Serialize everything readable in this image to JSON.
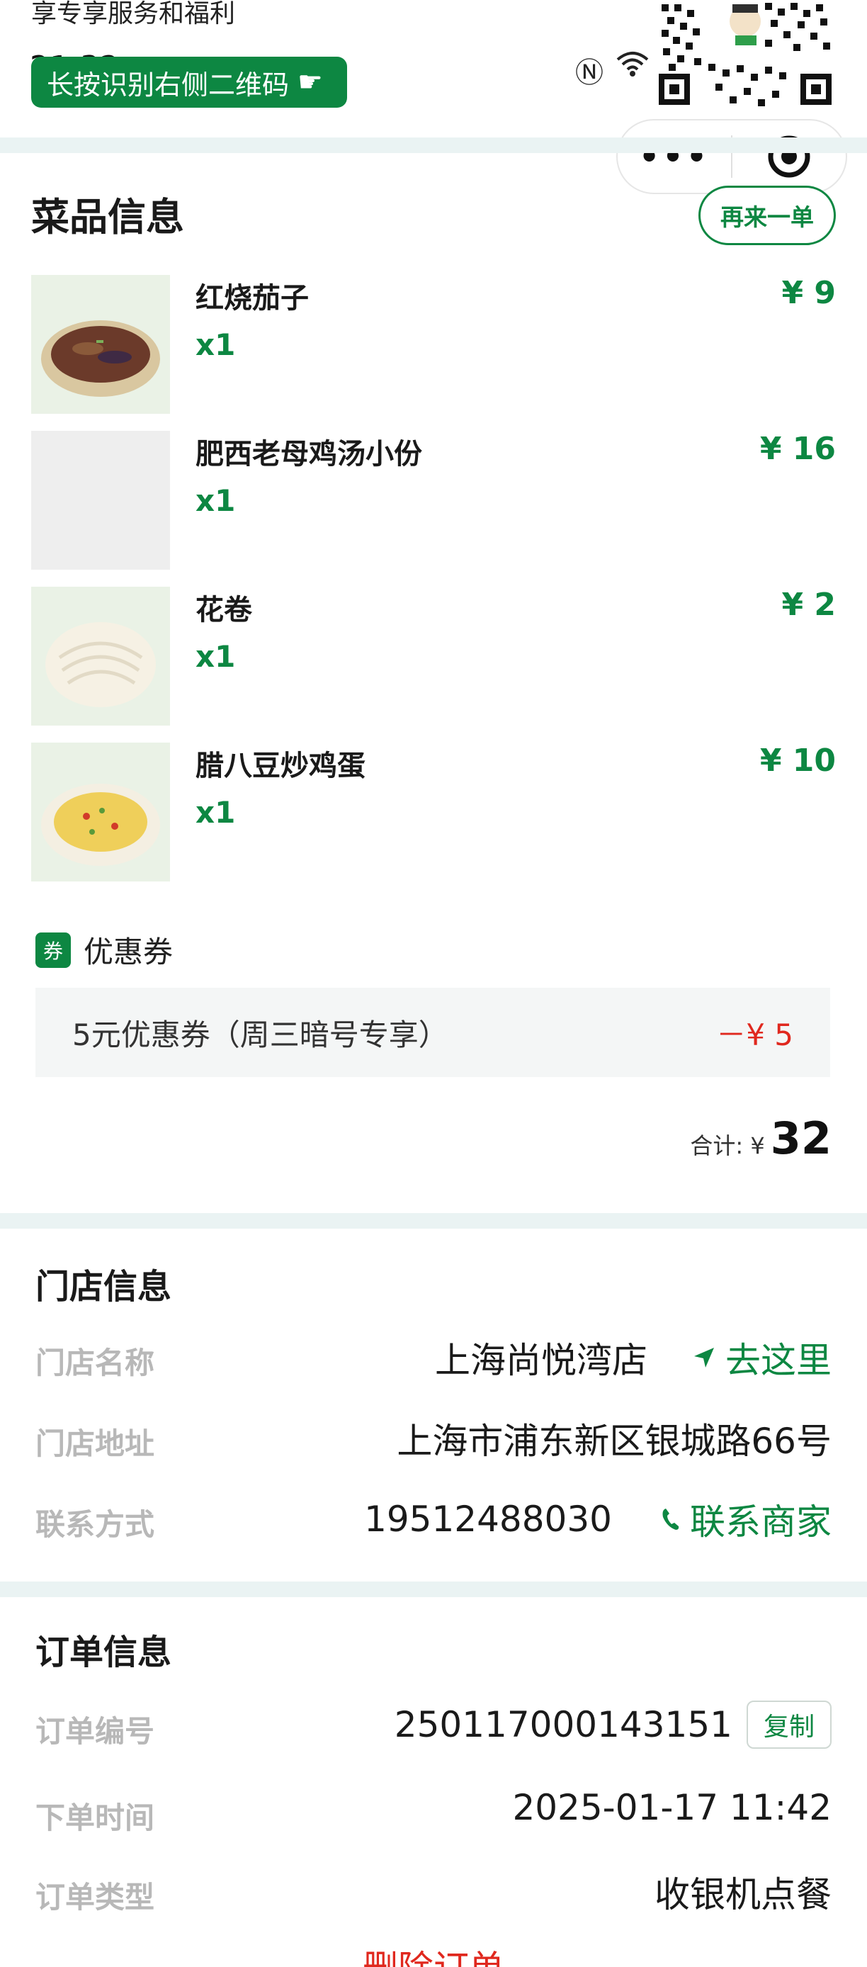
{
  "promo": {
    "text": "享专享服务和福利",
    "scan_banner": "长按识别右侧二维码"
  },
  "status_bar": {
    "time": "21:32"
  },
  "dishes_section": {
    "title": "菜品信息",
    "reorder_label": "再来一单",
    "items": [
      {
        "name": "红烧茄子",
        "qty": "x1",
        "price": "¥ 9"
      },
      {
        "name": "肥西老母鸡汤小份",
        "qty": "x1",
        "price": "¥ 16"
      },
      {
        "name": "花卷",
        "qty": "x1",
        "price": "¥ 2"
      },
      {
        "name": "腊八豆炒鸡蛋",
        "qty": "x1",
        "price": "¥ 10"
      }
    ],
    "coupon_badge": "券",
    "coupon_label": "优惠券",
    "coupon_name": "5元优惠券（周三暗号专享）",
    "coupon_amount": "－¥ 5",
    "total_label": "合计: ¥",
    "total_value": "32"
  },
  "store_section": {
    "title": "门店信息",
    "rows": [
      {
        "key": "门店名称",
        "value": "上海尚悦湾店",
        "action": "去这里"
      },
      {
        "key": "门店地址",
        "value": "上海市浦东新区银城路66号"
      },
      {
        "key": "联系方式",
        "value": "19512488030",
        "action": "联系商家"
      }
    ]
  },
  "order_section": {
    "title": "订单信息",
    "rows": [
      {
        "key": "订单编号",
        "value": "250117000143151",
        "action": "复制"
      },
      {
        "key": "下单时间",
        "value": "2025-01-17 11:42"
      },
      {
        "key": "订单类型",
        "value": "收银机点餐"
      }
    ],
    "delete_label": "删除订单"
  },
  "colors": {
    "brand_green": "#0d8742",
    "discount_red": "#e0281e",
    "section_gap": "#eaf3f3"
  }
}
